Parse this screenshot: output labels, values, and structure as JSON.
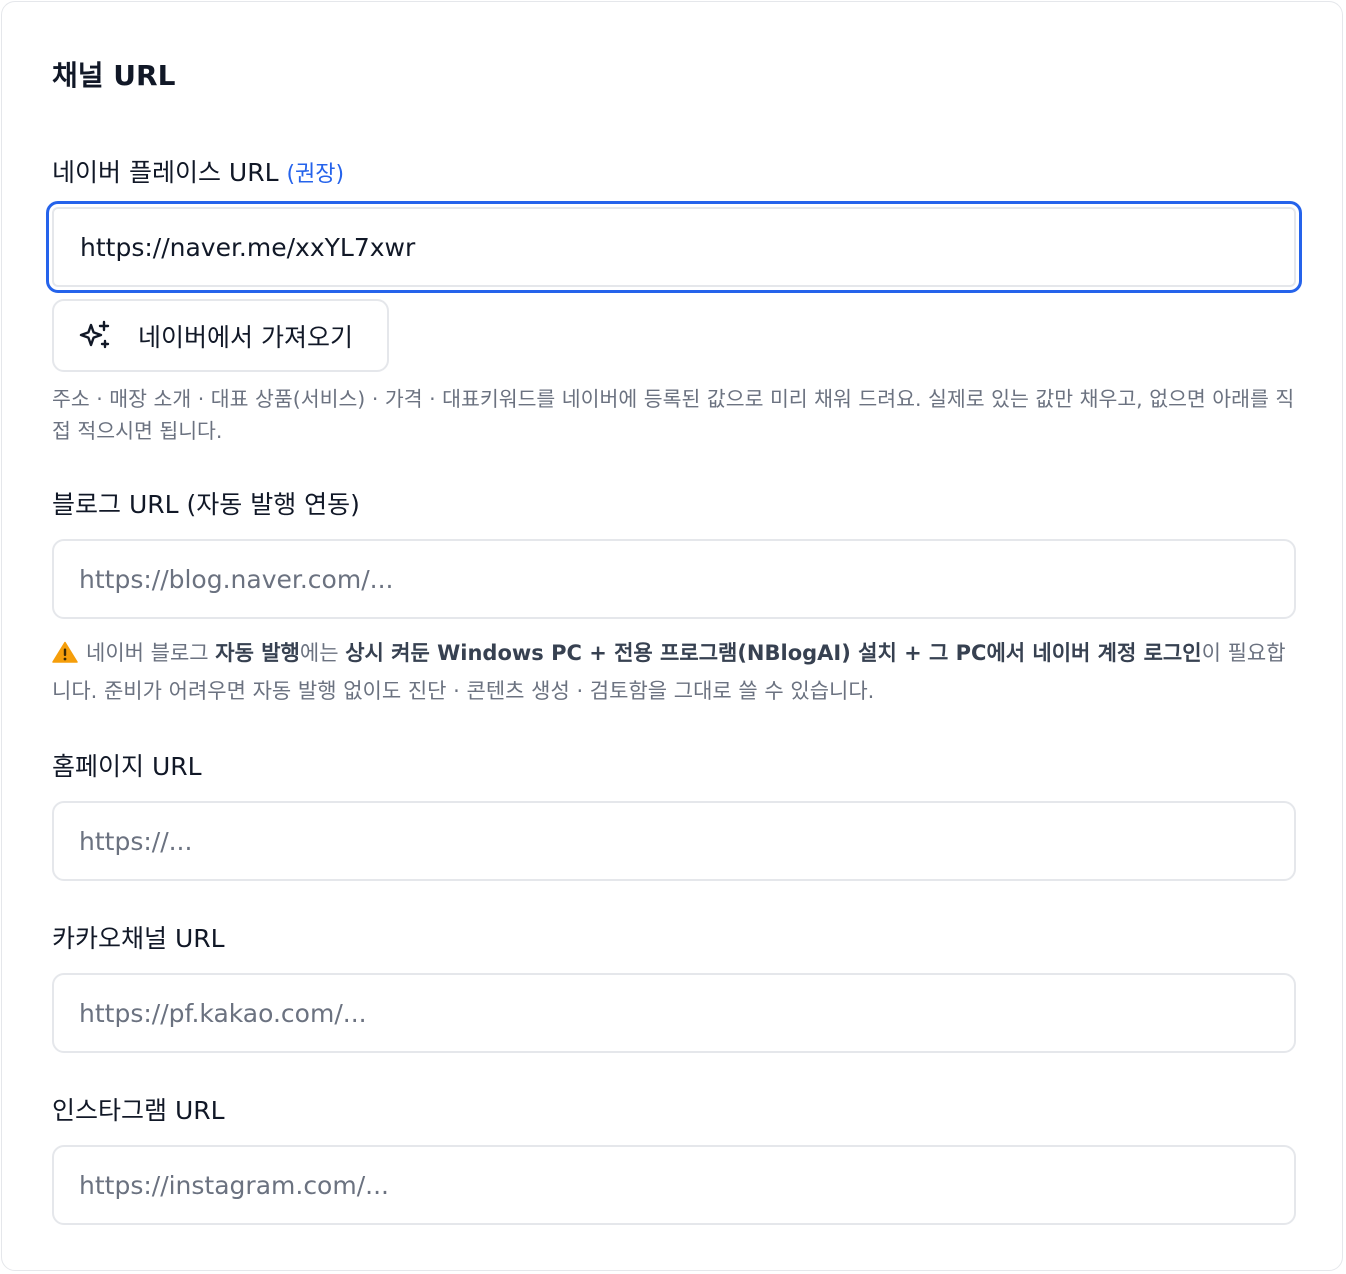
{
  "section_title": "채널 URL",
  "naver_place": {
    "label": "네이버 플레이스 URL",
    "recommended": "(권장)",
    "value": "https://naver.me/xxYL7xwr",
    "import_button": "네이버에서 가져오기",
    "help": "주소 · 매장 소개 · 대표 상품(서비스) · 가격 · 대표키워드를 네이버에 등록된 값으로 미리 채워 드려요. 실제로 있는 값만 채우고, 없으면 아래를 직접 적으시면 됩니다."
  },
  "blog": {
    "label": "블로그 URL (자동 발행 연동)",
    "placeholder": "https://blog.naver.com/...",
    "note": {
      "t1": "네이버 블로그 ",
      "b1": "자동 발행",
      "t2": "에는 ",
      "b2": "상시 켜둔 Windows PC + 전용 프로그램(NBlogAI) 설치 + 그 PC에서 네이버 계정 로그인",
      "t3": "이 필요합니다. 준비가 어려우면 자동 발행 없이도 진단 · 콘텐츠 생성 · 검토함을 그대로 쓸 수 있습니다."
    }
  },
  "homepage": {
    "label": "홈페이지 URL",
    "placeholder": "https://..."
  },
  "kakao": {
    "label": "카카오채널 URL",
    "placeholder": "https://pf.kakao.com/..."
  },
  "instagram": {
    "label": "인스타그램 URL",
    "placeholder": "https://instagram.com/..."
  },
  "colors": {
    "accent": "#2563eb",
    "border": "#e5e7eb",
    "muted": "#6b7280",
    "warning": "#f59e0b"
  },
  "icons": {
    "import": "sparkle-icon",
    "warning": "warning-icon"
  }
}
